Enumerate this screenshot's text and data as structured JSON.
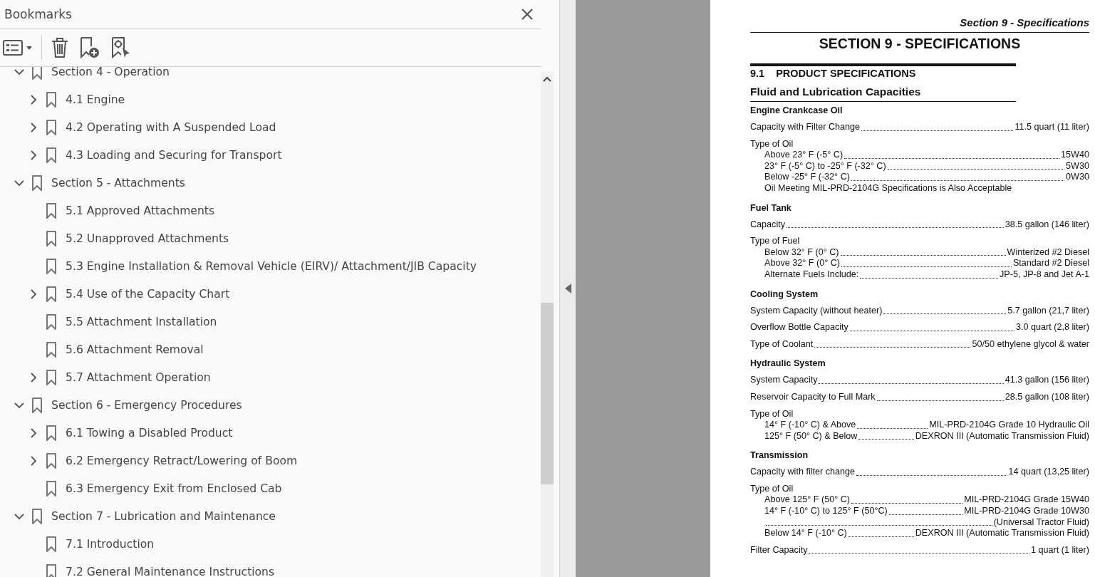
{
  "bookmarks_panel": {
    "title": "Bookmarks",
    "tree": [
      {
        "label": "Section 4 - Operation",
        "has_children": true,
        "expanded": true,
        "children": [
          {
            "label": "4.1 Engine",
            "has_children": true,
            "expanded": false
          },
          {
            "label": "4.2 Operating with A Suspended Load",
            "has_children": true,
            "expanded": false
          },
          {
            "label": "4.3 Loading and Securing for Transport",
            "has_children": true,
            "expanded": false
          }
        ]
      },
      {
        "label": "Section 5 - Attachments",
        "has_children": true,
        "expanded": true,
        "children": [
          {
            "label": "5.1 Approved Attachments",
            "has_children": false
          },
          {
            "label": "5.2 Unapproved Attachments",
            "has_children": false
          },
          {
            "label": "5.3 Engine Installation & Removal Vehicle (EIRV)/ Attachment/JIB Capacity",
            "has_children": false
          },
          {
            "label": "5.4 Use of the Capacity Chart",
            "has_children": true,
            "expanded": false
          },
          {
            "label": "5.5 Attachment Installation",
            "has_children": false
          },
          {
            "label": "5.6 Attachment Removal",
            "has_children": false
          },
          {
            "label": "5.7 Attachment Operation",
            "has_children": true,
            "expanded": false
          }
        ]
      },
      {
        "label": "Section 6 - Emergency Procedures",
        "has_children": true,
        "expanded": true,
        "children": [
          {
            "label": "6.1 Towing a Disabled Product",
            "has_children": true,
            "expanded": false
          },
          {
            "label": "6.2 Emergency Retract/Lowering of Boom",
            "has_children": true,
            "expanded": false
          },
          {
            "label": "6.3 Emergency Exit from Enclosed Cab",
            "has_children": false
          }
        ]
      },
      {
        "label": "Section 7 - Lubrication and Maintenance",
        "has_children": true,
        "expanded": true,
        "children": [
          {
            "label": "7.1 Introduction",
            "has_children": false
          },
          {
            "label": "7.2 General Maintenance Instructions",
            "has_children": false
          }
        ]
      }
    ]
  },
  "document": {
    "running_header": "Section 9 - Specifications",
    "title": "SECTION 9 - SPECIFICATIONS",
    "section": {
      "number": "9.1",
      "title": "PRODUCT SPECIFICATIONS"
    },
    "subtitle": "Fluid and Lubrication Capacities",
    "groups": [
      {
        "heading": "Engine Crankcase Oil",
        "entries": [
          {
            "label": "Capacity with Filter Change",
            "value": "11.5 quart (11 liter)"
          },
          {
            "label": "Type of Oil",
            "items": [
              {
                "label": "Above 23° F (-5° C)",
                "value": "15W40"
              },
              {
                "label": "23° F (-5° C) to -25° F (-32° C)",
                "value": "5W30"
              },
              {
                "label": "Below -25° F (-32° C)",
                "value": "0W30"
              },
              {
                "label": "Oil Meeting MIL-PRD-2104G Specifications is Also Acceptable"
              }
            ]
          }
        ]
      },
      {
        "heading": "Fuel Tank",
        "entries": [
          {
            "label": "Capacity",
            "value": "38.5 gallon (146 liter)"
          },
          {
            "label": "Type of Fuel",
            "items": [
              {
                "label": "Below 32° F (0° C)",
                "value": "Winterized #2 Diesel"
              },
              {
                "label": "Above 32° F (0° C)",
                "value": "Standard #2 Diesel"
              },
              {
                "label": "Alternate Fuels Include:",
                "value": "JP-5, JP-8 and Jet A-1"
              }
            ]
          }
        ]
      },
      {
        "heading": "Cooling System",
        "entries": [
          {
            "label": "System Capacity (without heater)",
            "value": "5.7 gallon (21,7 liter)"
          },
          {
            "label": "Overflow Bottle Capacity",
            "value": "3.0 quart (2,8 liter)"
          },
          {
            "label": "Type of Coolant",
            "value": "50/50 ethylene glycol & water"
          }
        ]
      },
      {
        "heading": "Hydraulic System",
        "entries": [
          {
            "label": "System Capacity",
            "value": "41.3 gallon (156 liter)"
          },
          {
            "label": "Reservoir Capacity to Full Mark",
            "value": "28.5 gallon (108 liter)"
          },
          {
            "label": "Type of Oil",
            "items": [
              {
                "label": "14° F (-10° C) & Above",
                "value": "MIL-PRD-2104G Grade 10 Hydraulic Oil"
              },
              {
                "label": "125° F (50° C) & Below",
                "value": "DEXRON III (Automatic Transmission Fluid)"
              }
            ]
          }
        ]
      },
      {
        "heading": "Transmission",
        "entries": [
          {
            "label": "Capacity with filter change",
            "value": "14 quart (13,25 liter)"
          },
          {
            "label": "Type of Oil",
            "items": [
              {
                "label": "Above 125° F (50° C)",
                "value": "MIL-PRD-2104G Grade 15W40"
              },
              {
                "label": "14° F (-10° C) to 125° F (50°C)",
                "value": "MIL-PRD-2104G Grade 10W30"
              },
              {
                "value": "(Universal Tractor Fluid)"
              },
              {
                "label": "Below 14° F (-10° C)",
                "value": "DEXRON III (Automatic Transmission Fluid)"
              }
            ]
          },
          {
            "label": "Filter Capacity",
            "value": "1 quart (1 liter)"
          }
        ]
      }
    ]
  }
}
